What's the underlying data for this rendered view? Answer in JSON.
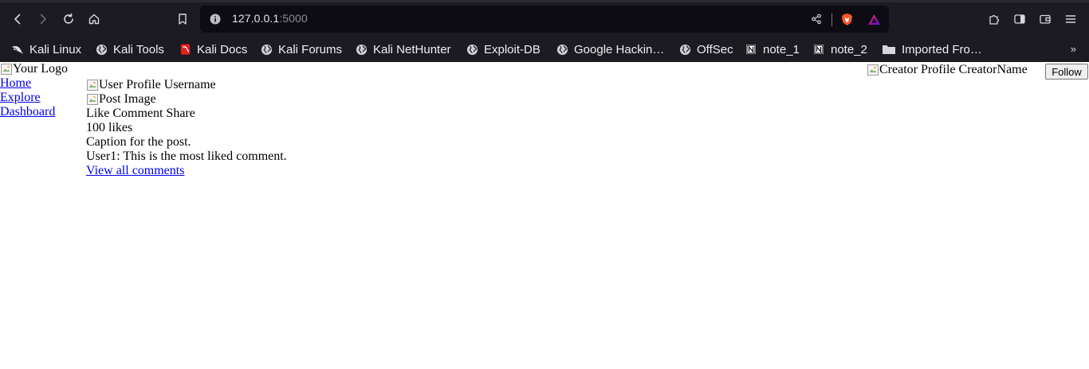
{
  "browser": {
    "url_host": "127.0.0.1",
    "url_port": ":5000",
    "accent_color": "#1c1b22"
  },
  "bookmarks": [
    {
      "label": "Kali Linux",
      "icon": "kali-dragon-icon"
    },
    {
      "label": "Kali Tools",
      "icon": "globe-icon"
    },
    {
      "label": "Kali Docs",
      "icon": "kali-docs-icon"
    },
    {
      "label": "Kali Forums",
      "icon": "globe-icon"
    },
    {
      "label": "Kali NetHunter",
      "icon": "globe-icon"
    },
    {
      "label": "Exploit-DB",
      "icon": "globe-icon"
    },
    {
      "label": "Google Hackin…",
      "icon": "globe-icon"
    },
    {
      "label": "OffSec",
      "icon": "globe-icon"
    },
    {
      "label": "note_1",
      "icon": "notion-icon"
    },
    {
      "label": "note_2",
      "icon": "notion-icon"
    },
    {
      "label": "Imported Fro…",
      "icon": "folder-icon"
    }
  ],
  "page": {
    "logo_alt": "Your Logo",
    "nav": [
      "Home",
      "Explore",
      "Dashboard"
    ],
    "post": {
      "profile_alt": "User Profile",
      "username": "Username",
      "image_alt": "Post Image",
      "actions": "Like Comment Share",
      "likes": "100 likes",
      "caption": "Caption for the post.",
      "top_comment": "User1: This is the most liked comment.",
      "view_all": "View all comments"
    },
    "creator": {
      "profile_alt": "Creator Profile",
      "name": "CreatorName",
      "follow_label": "Follow"
    }
  }
}
